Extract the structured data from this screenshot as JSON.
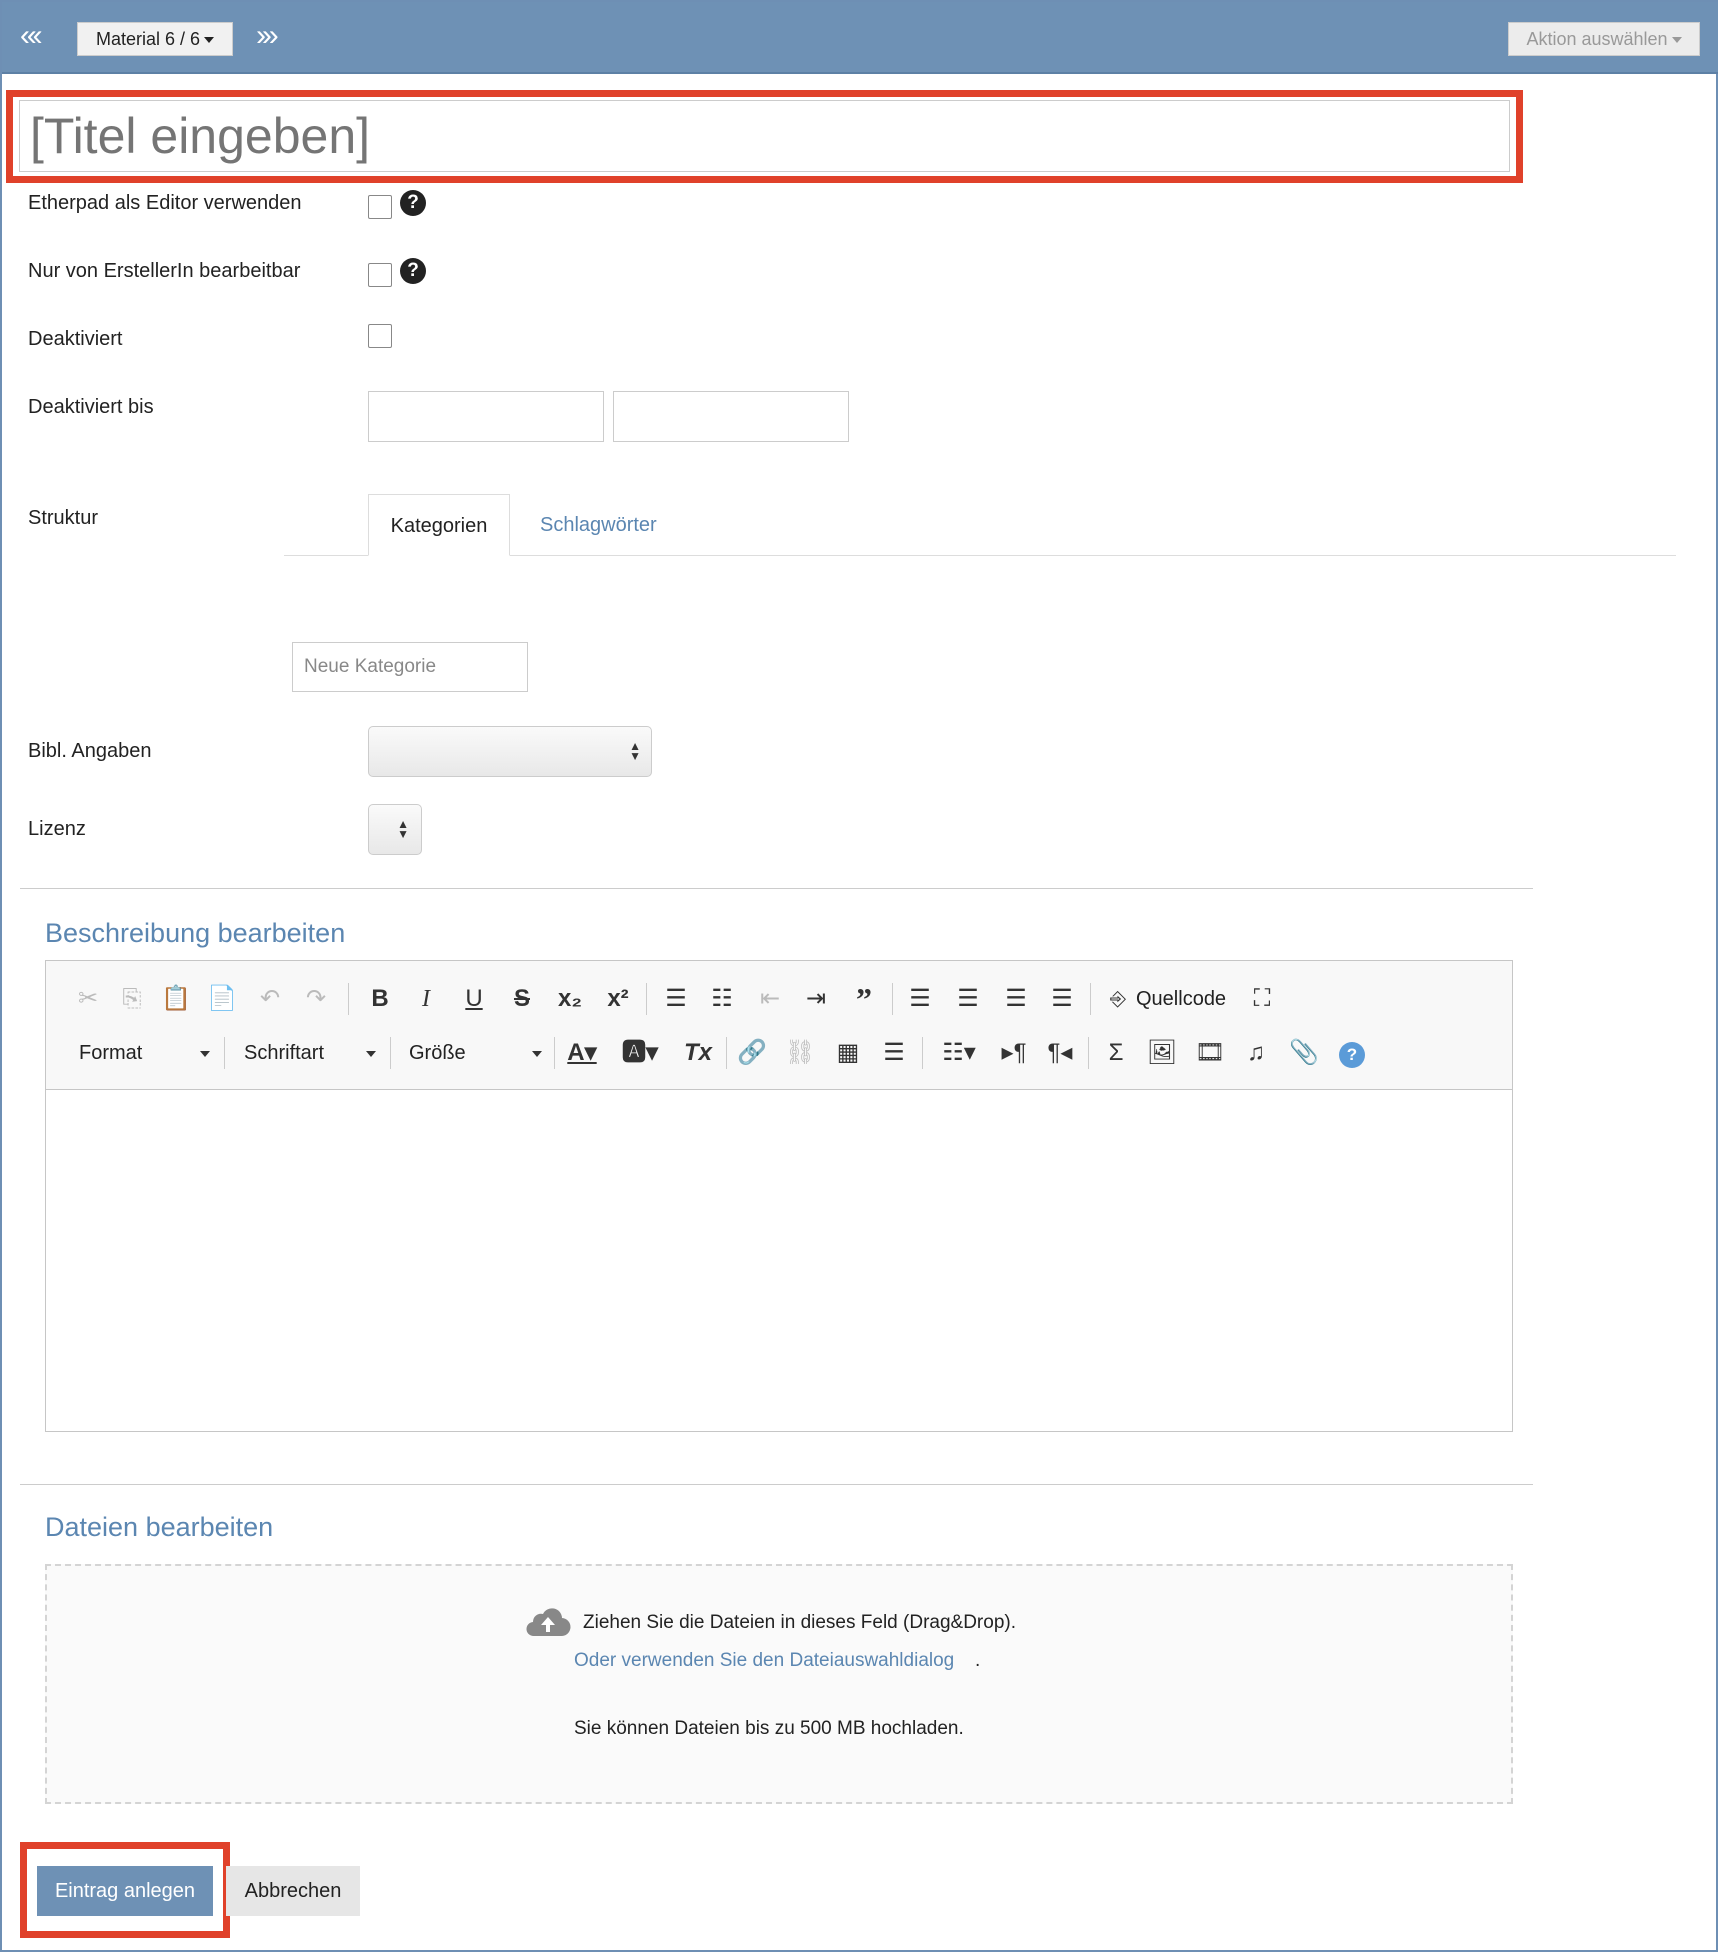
{
  "nav": {
    "first": "«‹",
    "next_last": "›»",
    "material_label": "Material 6 / 6",
    "action_label": "Aktion auswählen"
  },
  "title": {
    "placeholder": "[Titel eingeben]"
  },
  "form": {
    "etherpad_label": "Etherpad als Editor verwenden",
    "only_creator_label": "Nur von ErstellerIn bearbeitbar",
    "deactivated_label": "Deaktiviert",
    "deactivated_until_label": "Deaktiviert bis",
    "structure_label": "Struktur",
    "tabs": [
      {
        "label": "Kategorien"
      },
      {
        "label": "Schlagwörter"
      }
    ],
    "new_category_placeholder": "Neue Kategorie",
    "bibl_label": "Bibl. Angaben",
    "license_label": "Lizenz",
    "help_glyph": "?"
  },
  "description": {
    "heading": "Beschreibung bearbeiten",
    "source_label": "Quellcode",
    "format_label": "Format",
    "font_label": "Schriftart",
    "size_label": "Größe"
  },
  "files": {
    "heading": "Dateien bearbeiten",
    "drop_text": "Ziehen Sie die Dateien in dieses Feld (Drag&Drop).",
    "dialog_link": "Oder verwenden Sie den Dateiauswahldialog",
    "dialog_dot": ".",
    "limit_text": "Sie können Dateien bis zu 500 MB hochladen."
  },
  "actions": {
    "submit_label": "Eintrag anlegen",
    "cancel_label": "Abbrechen"
  },
  "colors": {
    "accent": "#6e91b5",
    "link": "#5b86b1",
    "highlight": "#e0412a"
  }
}
